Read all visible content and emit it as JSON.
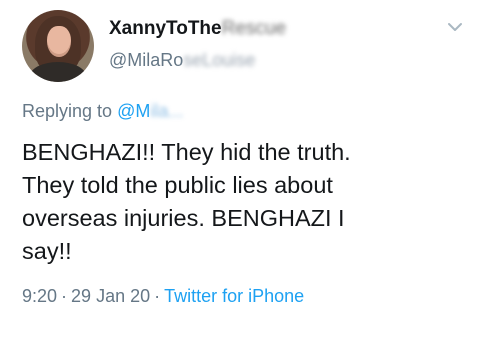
{
  "header": {
    "display_name_visible": "XannyToThe",
    "display_name_obscured": "Rescue",
    "handle_visible": "@MilaRo",
    "handle_obscured": "seLouise"
  },
  "reply": {
    "prefix": "Replying to",
    "mention_visible": "@M",
    "mention_obscured": "ila..."
  },
  "tweet": {
    "lines": [
      "BENGHAZI!!  They hid the truth.",
      "They told the public lies about",
      "overseas injuries. BENGHAZI I",
      "say!!"
    ]
  },
  "meta": {
    "time": "9:20",
    "separator_1": "·",
    "date": "29 Jan 20",
    "separator_2": "·",
    "source": "Twitter for iPhone"
  },
  "icons": {
    "avatar": "avatar",
    "menu": "chevron-down-icon"
  },
  "colors": {
    "text": "#14171a",
    "secondary": "#657786",
    "link": "#1da1f2",
    "background": "#ffffff"
  }
}
